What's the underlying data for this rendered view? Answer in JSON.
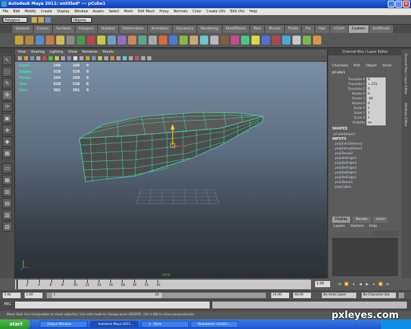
{
  "window": {
    "title": "Autodesk Maya 2011: untitled*   ---   pCube1"
  },
  "menubar": [
    "File",
    "Edit",
    "Modify",
    "Create",
    "Display",
    "Window",
    "Assets",
    "Select",
    "Mesh",
    "Edit Mesh",
    "Proxy",
    "Normals",
    "Color",
    "Create UVs",
    "Edit UVs",
    "Help"
  ],
  "statusline": {
    "menuset": "Polygons",
    "selection_mode": "Objects"
  },
  "shelf_tabs": [
    {
      "label": "General",
      "active": false
    },
    {
      "label": "Curves",
      "active": false
    },
    {
      "label": "Surfaces",
      "active": false
    },
    {
      "label": "Polygons",
      "active": false
    },
    {
      "label": "Subdivs",
      "active": false
    },
    {
      "label": "Deformation",
      "active": false
    },
    {
      "label": "Animation",
      "active": false
    },
    {
      "label": "Dynamics",
      "active": false
    },
    {
      "label": "Rendering",
      "active": false
    },
    {
      "label": "PaintEffects",
      "active": false
    },
    {
      "label": "Toon",
      "active": false
    },
    {
      "label": "Muscle",
      "active": false
    },
    {
      "label": "Fluids",
      "active": false
    },
    {
      "label": "Fur",
      "active": false
    },
    {
      "label": "Hair",
      "active": false
    },
    {
      "label": "nCloth",
      "active": false
    },
    {
      "label": "Custom",
      "active": true
    },
    {
      "label": "GoZBrush",
      "active": false
    }
  ],
  "viewport_menu": [
    "View",
    "Shading",
    "Lighting",
    "Show",
    "Renderer",
    "Panels"
  ],
  "hud": [
    {
      "label": "Verts:",
      "value": "266",
      "selected": "266",
      "extra": "0"
    },
    {
      "label": "Edges:",
      "value": "528",
      "selected": "528",
      "extra": "0"
    },
    {
      "label": "Faces:",
      "value": "264",
      "selected": "264",
      "extra": "0"
    },
    {
      "label": "Tris:",
      "value": "528",
      "selected": "528",
      "extra": "0"
    },
    {
      "label": "UVs:",
      "value": "301",
      "selected": "301",
      "extra": "0"
    }
  ],
  "viewport_camera": "persp",
  "channel_box": {
    "title": "Channel Box / Layer Editor",
    "menu": [
      "Channels",
      "Edit",
      "Object",
      "Show"
    ],
    "object": "pCube1",
    "attributes": [
      {
        "name": "Translate X",
        "value": "0"
      },
      {
        "name": "Translate Y",
        "value": "+.272"
      },
      {
        "name": "Translate Z",
        "value": "0"
      },
      {
        "name": "Rotate X",
        "value": "0"
      },
      {
        "name": "Rotate Y",
        "value": "-90"
      },
      {
        "name": "Rotate Z",
        "value": "0"
      },
      {
        "name": "Scale X",
        "value": "1"
      },
      {
        "name": "Scale Y",
        "value": "1"
      },
      {
        "name": "Scale Z",
        "value": "1"
      },
      {
        "name": "Visibility",
        "value": "on"
      }
    ],
    "shapes_label": "SHAPES",
    "shape": "pCubeShape1",
    "inputs_label": "INPUTS",
    "inputs": [
      "polyExtrudeFace2",
      "polyExtrudeFace1",
      "polyTweak2",
      "polyDelEdge5",
      "polyDelEdge4",
      "polyDelEdge3",
      "polyDelEdge2",
      "polyDelEdge1",
      "polyTweak1",
      "polyCube1"
    ]
  },
  "layer_editor": {
    "tabs": [
      {
        "label": "Display",
        "active": true
      },
      {
        "label": "Render",
        "active": false
      },
      {
        "label": "Anim",
        "active": false
      }
    ],
    "menu": [
      "Layers",
      "Options",
      "Help"
    ]
  },
  "side_tabs": [
    "Channel Box / Layer Editor",
    "Attribute Editor"
  ],
  "timeslider": {
    "ticks": [
      "2",
      "4",
      "6",
      "8",
      "10",
      "12",
      "14",
      "16",
      "18",
      "20",
      "22",
      "24"
    ],
    "current_frame": "1.00"
  },
  "range": {
    "start": "1.00",
    "range_start": "1.00",
    "range_mark": "1",
    "range_end_mark": "24",
    "end": "24.00",
    "max": "48.00",
    "anim_layer": "No Anim Layer",
    "char_set": "No Character Set"
  },
  "mel_label": "MEL",
  "help_line": "Move Tool: Use manipulator to move object(s). Use edit mode to change pivot (INSERT). Ctrl+LMB to move perpendicular.",
  "taskbar": {
    "start": "start",
    "tasks": [
      {
        "label": "Output Window",
        "active": false
      },
      {
        "label": "Autodesk Maya 2011...",
        "active": true
      },
      {
        "label": "1 - Paint",
        "active": false
      },
      {
        "label": "Rezultatele căutării...",
        "active": false
      }
    ]
  },
  "watermark": "pxleyes.com"
}
